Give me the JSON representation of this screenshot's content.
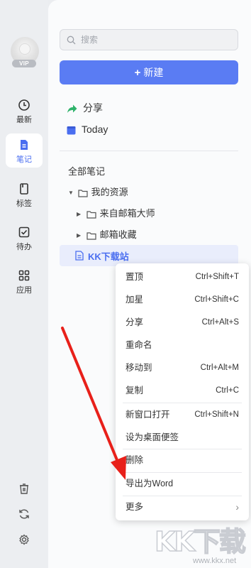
{
  "rail": {
    "vip_badge": "VIP",
    "nav": [
      {
        "label": "最新",
        "icon": "clock-icon"
      },
      {
        "label": "笔记",
        "icon": "note-icon",
        "active": true
      },
      {
        "label": "标签",
        "icon": "bookmark-icon"
      },
      {
        "label": "待办",
        "icon": "checkbox-icon"
      },
      {
        "label": "应用",
        "icon": "apps-grid-icon"
      }
    ],
    "tools": [
      "trash-icon",
      "sync-icon",
      "settings-gear-icon"
    ]
  },
  "search": {
    "placeholder": "搜索"
  },
  "new_button": {
    "plus": "+",
    "label": "新建"
  },
  "quick": {
    "share": "分享",
    "today": "Today"
  },
  "tree": {
    "section": "全部笔记",
    "root": "我的资源",
    "children": [
      "来自邮箱大师",
      "邮箱收藏"
    ],
    "selected_note": "KK下载站"
  },
  "context_menu": {
    "items": [
      {
        "label": "置顶",
        "shortcut": "Ctrl+Shift+T"
      },
      {
        "label": "加星",
        "shortcut": "Ctrl+Shift+C"
      },
      {
        "label": "分享",
        "shortcut": "Ctrl+Alt+S"
      },
      {
        "label": "重命名",
        "shortcut": ""
      },
      {
        "label": "移动到",
        "shortcut": "Ctrl+Alt+M"
      },
      {
        "label": "复制",
        "shortcut": "Ctrl+C"
      },
      {
        "label": "新窗口打开",
        "shortcut": "Ctrl+Shift+N"
      },
      {
        "label": "设为桌面便签",
        "shortcut": ""
      },
      {
        "label": "删除",
        "shortcut": ""
      },
      {
        "label": "导出为Word",
        "shortcut": ""
      },
      {
        "label": "更多",
        "shortcut": "›"
      }
    ]
  },
  "watermark": {
    "text": "KK下载",
    "url": "www.kkx.net"
  },
  "colors": {
    "accent": "#5a7cf3",
    "share_green": "#2fb36b",
    "annotation_arrow": "#e8201a"
  }
}
